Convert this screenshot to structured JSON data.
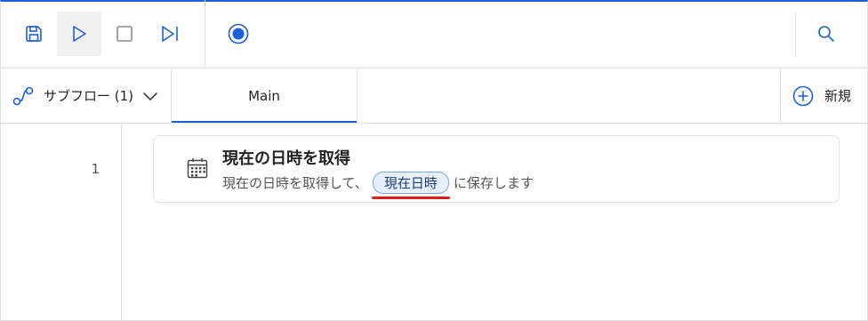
{
  "toolbar": {
    "buttons": [
      {
        "name": "save",
        "icon": "save-icon"
      },
      {
        "name": "run",
        "icon": "play-icon"
      },
      {
        "name": "stop",
        "icon": "stop-icon"
      },
      {
        "name": "step",
        "icon": "step-next-icon"
      },
      {
        "name": "record",
        "icon": "record-icon"
      },
      {
        "name": "search",
        "icon": "search-icon"
      }
    ]
  },
  "tabs": {
    "subflow_label": "サブフロー (1)",
    "main_label": "Main",
    "new_label": "新規"
  },
  "editor": {
    "line_number": "1",
    "action": {
      "icon": "calendar-icon",
      "title": "現在の日時を取得",
      "desc_prefix": "現在の日時を取得して、",
      "variable": "現在日時",
      "desc_suffix": "に保存します"
    }
  },
  "colors": {
    "accent": "#1e5fd8",
    "pill_bg": "#e6f0ff",
    "highlight_underline": "#e01b1b"
  }
}
